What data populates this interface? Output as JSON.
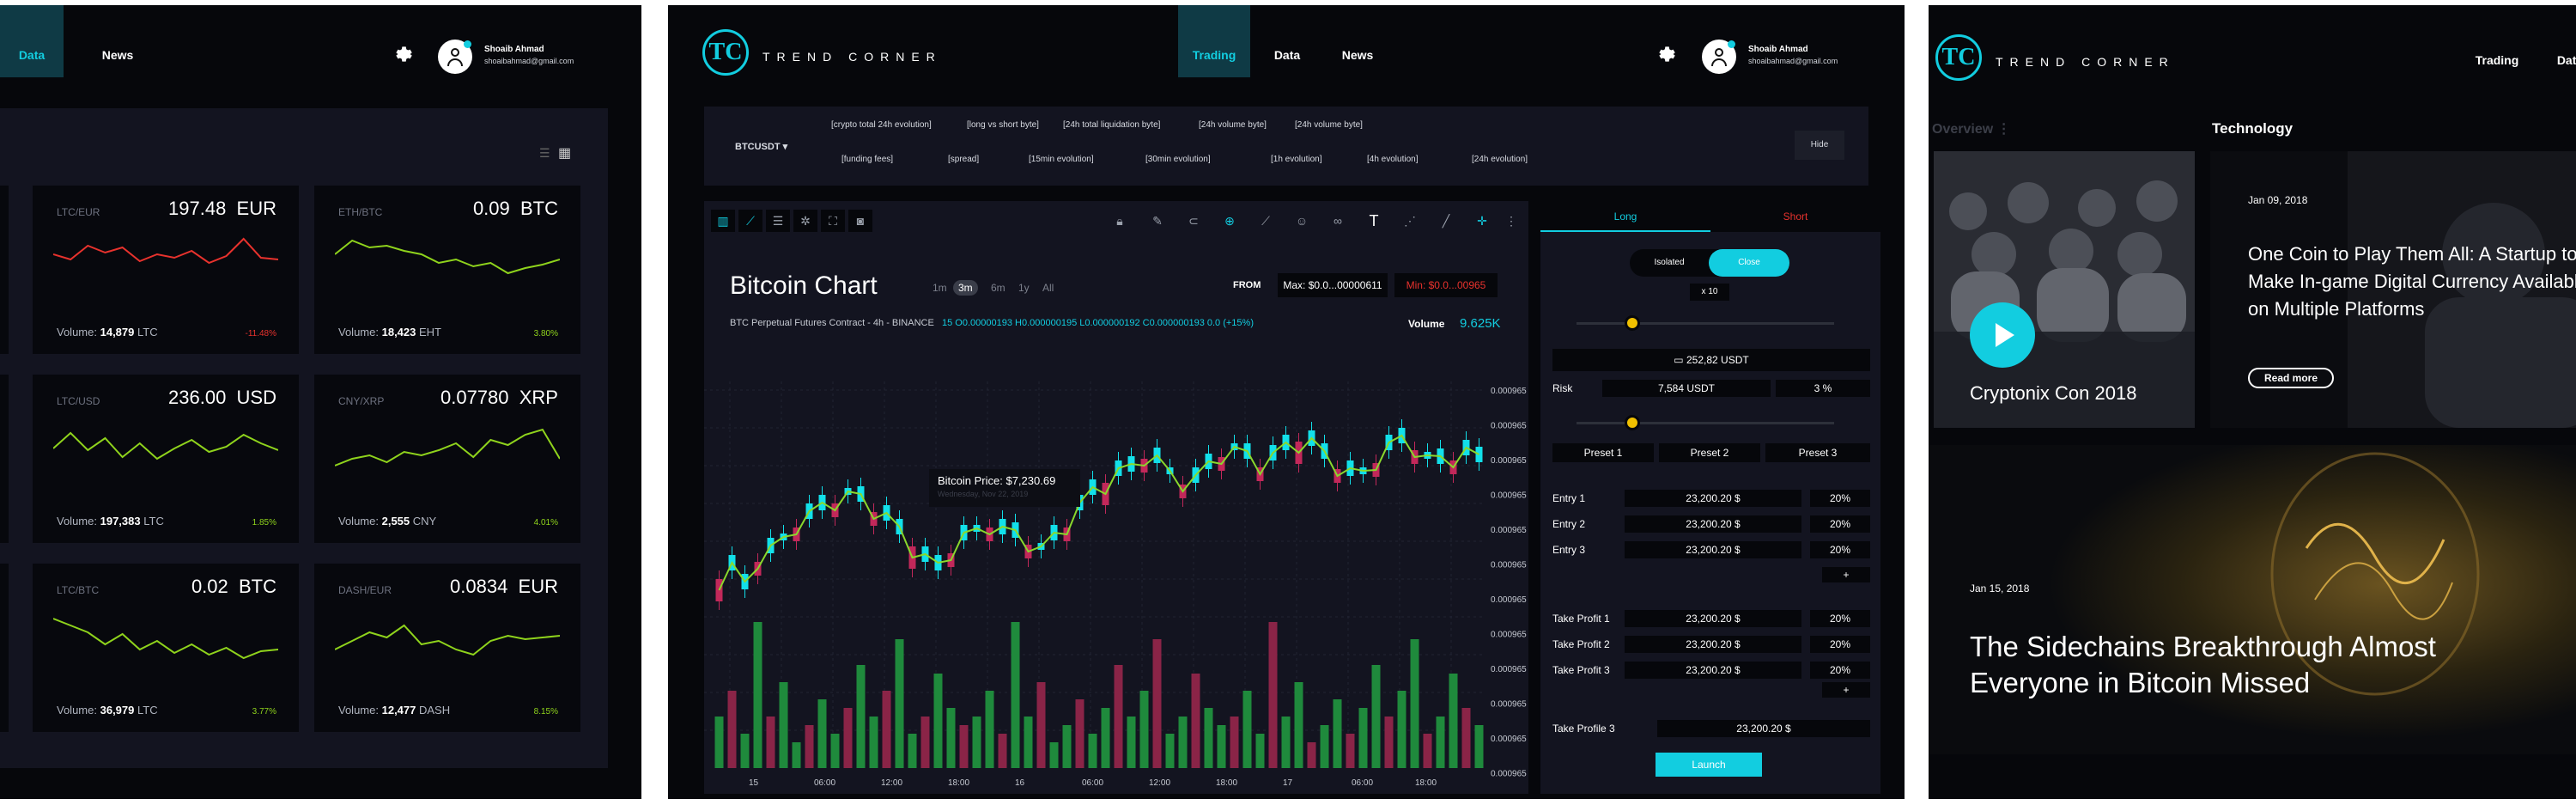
{
  "screen1": {
    "nav": {
      "data": "Data",
      "news": "News"
    },
    "user": {
      "name": "Shoaib Ahmad",
      "email": "shoaibahmad@gmail.com"
    },
    "cards": [
      {
        "pair": "LTC/EUR",
        "value": "197.48",
        "unit": "EUR",
        "volume": "14,879",
        "vol_unit": "LTC",
        "pct": "-11.48%",
        "color": "#e8322d"
      },
      {
        "pair": "ETH/BTC",
        "value": "0.09",
        "unit": "BTC",
        "volume": "18,423",
        "vol_unit": "EHT",
        "pct": "3.80%",
        "color": "#8fd31c"
      },
      {
        "pair": "LTC/USD",
        "value": "236.00",
        "unit": "USD",
        "volume": "197,383",
        "vol_unit": "LTC",
        "pct": "1.85%",
        "color": "#8fd31c"
      },
      {
        "pair": "CNY/XRP",
        "value": "0.07780",
        "unit": "XRP",
        "volume": "2,555",
        "vol_unit": "CNY",
        "pct": "4.01%",
        "color": "#8fd31c"
      },
      {
        "pair": "LTC/BTC",
        "value": "0.02",
        "unit": "BTC",
        "volume": "36,979",
        "vol_unit": "LTC",
        "pct": "3.77%",
        "color": "#8fd31c"
      },
      {
        "pair": "DASH/EUR",
        "value": "0.0834",
        "unit": "EUR",
        "volume": "12,477",
        "vol_unit": "DASH",
        "pct": "8.15%",
        "color": "#8fd31c"
      }
    ],
    "volume_label": "Volume:"
  },
  "screen2": {
    "brand": "TREND CORNER",
    "nav": {
      "trading": "Trading",
      "data": "Data",
      "news": "News"
    },
    "user": {
      "name": "Shoaib Ahmad",
      "email": "shoaibahmad@gmail.com"
    },
    "pair": "BTCUSDT",
    "top_row": [
      "[crypto total 24h evolution]",
      "[long vs short byte]",
      "[24h total liquidation byte]",
      "[24h volume byte]",
      "[24h volume byte]"
    ],
    "bottom_row": [
      "[funding fees]",
      "[spread]",
      "[15min evolution]",
      "[30min evolution]",
      "[1h evolution]",
      "[4h evolution]",
      "[24h evolution]"
    ],
    "hide": "Hide",
    "chart": {
      "title": "Bitcoin Chart",
      "ranges": [
        "1m",
        "3m",
        "6m",
        "1y",
        "All"
      ],
      "active_range": "3m",
      "from": "FROM",
      "max": "Max: $0.0...00000611",
      "min": "Min: $0.0...00965",
      "subtitle": "BTC Perpetual Futures Contract - 4h - BINANCE",
      "ohlc": "15 O0.00000193 H0.000000195 L0.000000192 C0.000000193 0.0 (+15%)",
      "volume_label": "Volume",
      "volume_value": "9.625K",
      "tooltip_price": "Bitcoin Price: $7,230.69",
      "tooltip_date": "Wednesday, Nov 22, 2019",
      "y_ticks": [
        "0.000965",
        "0.000965",
        "0.000965",
        "0.000965",
        "0.000965",
        "0.000965",
        "0.000965",
        "0.000965",
        "0.000965",
        "0.000965",
        "0.000965",
        "0.000965"
      ],
      "x_ticks": [
        "15",
        "06:00",
        "12:00",
        "18:00",
        "16",
        "06:00",
        "12:00",
        "18:00",
        "17",
        "06:00",
        "18:00"
      ]
    },
    "order": {
      "tab_long": "Long",
      "tab_short": "Short",
      "isolated": "Isolated",
      "close": "Close",
      "leverage": "x 10",
      "balance": "252,82 USDT",
      "risk_label": "Risk",
      "risk_value": "7,584 USDT",
      "risk_pct": "3 %",
      "presets": [
        "Preset 1",
        "Preset 2",
        "Preset 3"
      ],
      "entries": [
        {
          "label": "Entry 1",
          "value": "23,200.20 $",
          "pct": "20%"
        },
        {
          "label": "Entry 2",
          "value": "23,200.20 $",
          "pct": "20%"
        },
        {
          "label": "Entry 3",
          "value": "23,200.20 $",
          "pct": "20%"
        }
      ],
      "takes": [
        {
          "label": "Take Profit 1",
          "value": "23,200.20 $",
          "pct": "20%"
        },
        {
          "label": "Take Profit 2",
          "value": "23,200.20 $",
          "pct": "20%"
        },
        {
          "label": "Take Profit 3",
          "value": "23,200.20 $",
          "pct": "20%"
        }
      ],
      "plus": "+",
      "final_label": "Take Profile 3",
      "final_value": "23,200.20 $",
      "launch": "Launch"
    }
  },
  "screen3": {
    "brand": "TREND CORNER",
    "nav": {
      "trading": "Trading",
      "data": "Data"
    },
    "overview": "Overview",
    "technology": "Technology",
    "video_title": "Cryptonix Con 2018",
    "article1": {
      "date": "Jan 09, 2018",
      "title": "One Coin to Play Them All: A Startup to Make In-game Digital Currency Available on Multiple Platforms",
      "read_more": "Read more"
    },
    "article2": {
      "date": "Jan 15, 2018",
      "title": "The Sidechains Breakthrough Almost Everyone in Bitcoin Missed"
    }
  }
}
